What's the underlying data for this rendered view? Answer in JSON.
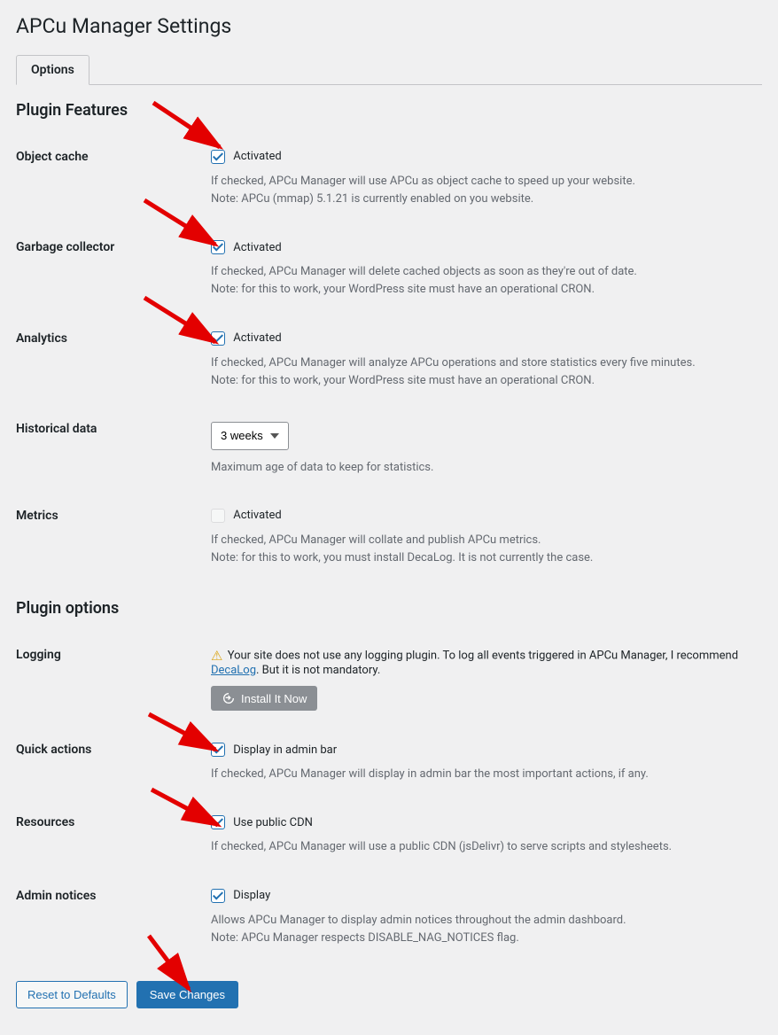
{
  "page": {
    "title": "APCu Manager Settings",
    "tab": "Options"
  },
  "sections": {
    "features": "Plugin Features",
    "options": "Plugin options"
  },
  "fields": {
    "object_cache": {
      "label": "Object cache",
      "cb_label": "Activated",
      "desc": "If checked, APCu Manager will use APCu as object cache to speed up your website.\nNote: APCu (mmap) 5.1.21 is currently enabled on you website."
    },
    "garbage_collector": {
      "label": "Garbage collector",
      "cb_label": "Activated",
      "desc": "If checked, APCu Manager will delete cached objects as soon as they're out of date.\nNote: for this to work, your WordPress site must have an operational CRON."
    },
    "analytics": {
      "label": "Analytics",
      "cb_label": "Activated",
      "desc": "If checked, APCu Manager will analyze APCu operations and store statistics every five minutes.\nNote: for this to work, your WordPress site must have an operational CRON."
    },
    "historical": {
      "label": "Historical data",
      "select_value": "3 weeks",
      "desc": "Maximum age of data to keep for statistics."
    },
    "metrics": {
      "label": "Metrics",
      "cb_label": "Activated",
      "desc": "If checked, APCu Manager will collate and publish APCu metrics.\nNote: for this to work, you must install DecaLog. It is not currently the case."
    },
    "logging": {
      "label": "Logging",
      "msg_before": "Your site does not use any logging plugin. To log all events triggered in APCu Manager, I recommend ",
      "link_text": "DecaLog",
      "msg_after": ". But it is not mandatory.",
      "install_btn": "Install It Now"
    },
    "quick_actions": {
      "label": "Quick actions",
      "cb_label": "Display in admin bar",
      "desc": "If checked, APCu Manager will display in admin bar the most important actions, if any."
    },
    "resources": {
      "label": "Resources",
      "cb_label": "Use public CDN",
      "desc": "If checked, APCu Manager will use a public CDN (jsDelivr) to serve scripts and stylesheets."
    },
    "admin_notices": {
      "label": "Admin notices",
      "cb_label": "Display",
      "desc": "Allows APCu Manager to display admin notices throughout the admin dashboard.\nNote: APCu Manager respects DISABLE_NAG_NOTICES flag."
    }
  },
  "buttons": {
    "reset": "Reset to Defaults",
    "save": "Save Changes"
  }
}
